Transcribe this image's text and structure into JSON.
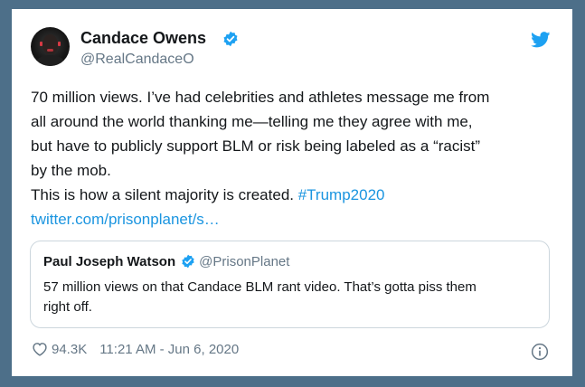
{
  "author": {
    "name": "Candace Owens",
    "handle": "@RealCandaceO",
    "avatar_icon": "avatar-photo"
  },
  "brand": {
    "icon": "twitter-bird-icon",
    "color": "#1da1f2"
  },
  "tweet": {
    "lines": [
      "70 million views. I’ve had celebrities and athletes message me from",
      "all around the world thanking me—telling me they agree with me,",
      "but have to publicly support BLM or risk being labeled as a “racist”",
      "by the mob."
    ],
    "last_line_text": "This is how a silent majority is created. ",
    "hashtag": "#Trump2020",
    "link": "twitter.com/prisonplanet/s…"
  },
  "quote": {
    "name": "Paul Joseph Watson",
    "handle": "@PrisonPlanet",
    "lines": [
      "57 million views on that Candace BLM rant video. That’s gotta piss them",
      "right off."
    ]
  },
  "footer": {
    "likes": "94.3K",
    "timestamp": "11:21 AM - Jun 6, 2020"
  },
  "colors": {
    "frame": "#4d6f89",
    "link": "#1b95e0",
    "verified": "#1da1f2",
    "muted": "#657786"
  }
}
